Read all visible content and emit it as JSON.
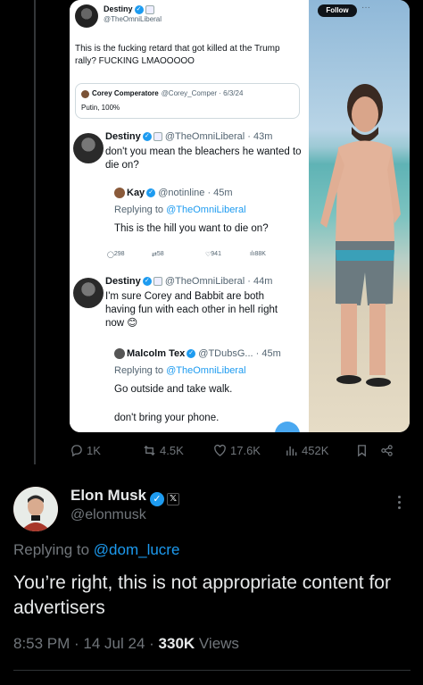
{
  "embedded": {
    "header": {
      "name": "Destiny",
      "handle": "@TheOmniLiberal",
      "follow_label": "Follow",
      "more": "···"
    },
    "original_text": "This is the fucking retard that got killed at the Trump rally? FUCKING LMAOOOOO",
    "quote": {
      "name": "Corey Comperatore",
      "meta": "@Corey_Comper · 6/3/24",
      "text": "Putin, 100%"
    },
    "reply1": {
      "name": "Destiny",
      "meta": "@TheOmniLiberal · 43m",
      "text": "don't you mean the bleachers he wanted to die on?"
    },
    "nested": {
      "name": "Kay",
      "meta": "@notinline · 45m",
      "replying_prefix": "Replying to",
      "replying_mention": "@TheOmniLiberal",
      "text": "This is the hill you want to die on?",
      "stats": {
        "replies": "298",
        "reposts": "58",
        "likes": "941",
        "views": "88K"
      }
    },
    "reply2": {
      "name": "Destiny",
      "meta": "@TheOmniLiberal · 44m",
      "text": "I'm sure Corey and Babbit are both having fun with each other in hell right now 😊"
    },
    "nested2": {
      "name": "Malcolm Tex",
      "meta": "@TDubsG... · 45m",
      "replying_prefix": "Replying to",
      "replying_mention": "@TheOmniLiberal",
      "line1": "Go outside and take walk.",
      "line2": "don't bring your phone."
    }
  },
  "actions": {
    "replies": "1K",
    "reposts": "4.5K",
    "likes": "17.6K",
    "views": "452K"
  },
  "tweet": {
    "name": "Elon Musk",
    "handle": "@elonmusk",
    "replying_prefix": "Replying to",
    "replying_mention": "@dom_lucre",
    "text": "You’re right, this is not appropriate content for advertisers",
    "time": "8:53 PM · 14 Jul 24 · ",
    "views_count": "330K",
    "views_label": " Views"
  },
  "colors": {
    "accent": "#1d9bf0",
    "muted": "#71767b",
    "text": "#e7e9ea",
    "background": "#000000"
  }
}
